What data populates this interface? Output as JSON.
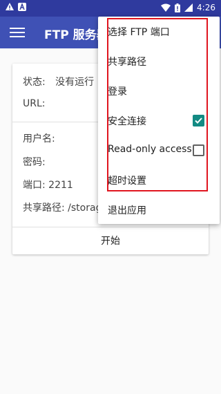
{
  "status_bar": {
    "time": "4:26",
    "icons": [
      "warning-icon",
      "notification-a-icon",
      "wifi-icon",
      "battery-alert-icon",
      "signal-icon"
    ]
  },
  "app_bar": {
    "title": "FTP 服务器",
    "menu_icon": "hamburger-icon"
  },
  "card": {
    "status_label": "状态:",
    "status_value": "没有运行",
    "url_label": "URL:",
    "username_label": "用户名:",
    "password_label": "密码:",
    "port_label": "端口: 2211",
    "share_path_label": "共享路径: /storag",
    "start_button": "开始"
  },
  "menu": {
    "items": [
      {
        "label": "选择 FTP 端口"
      },
      {
        "label": "共享路径"
      },
      {
        "label": "登录"
      },
      {
        "label": "安全连接",
        "checkbox": true,
        "checked": true
      },
      {
        "label": "Read-only access",
        "checkbox": true,
        "checked": false
      },
      {
        "label": "超时设置"
      },
      {
        "label": "退出应用"
      }
    ]
  },
  "colors": {
    "app_bar": "#3f51b5",
    "status_bar": "#2f3a9e",
    "checkbox_checked": "#138a83",
    "highlight": "#e0141e"
  }
}
